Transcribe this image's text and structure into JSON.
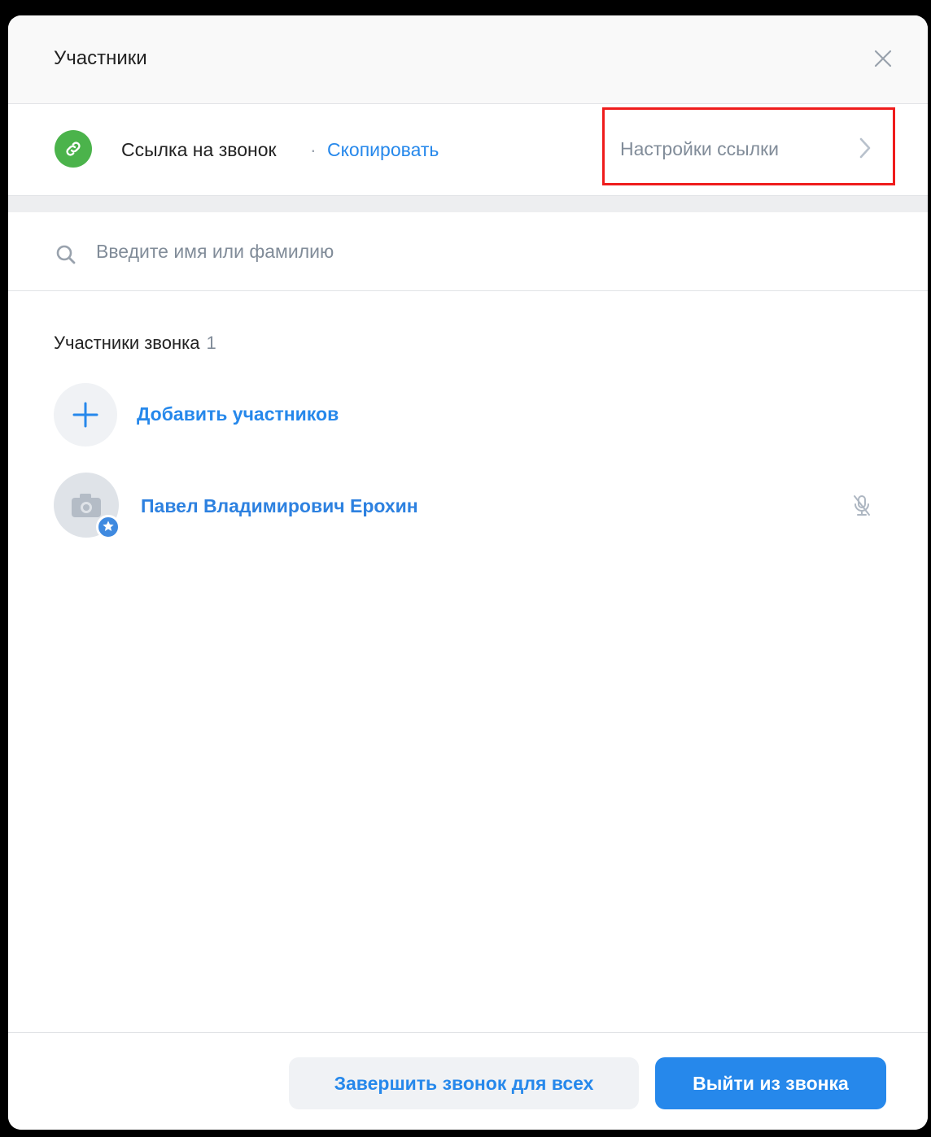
{
  "header": {
    "title": "Участники",
    "close_icon": "close-icon"
  },
  "call_link": {
    "icon": "link-icon",
    "icon_color": "#4bb34b",
    "label": "Ссылка на звонок",
    "separator": "·",
    "copy_label": "Скопировать",
    "settings_label": "Настройки ссылки",
    "settings_icon": "chevron-right-icon",
    "highlight_color": "#ef1c1c"
  },
  "search": {
    "icon": "search-icon",
    "placeholder": "Введите имя или фамилию",
    "value": ""
  },
  "participants": {
    "title": "Участники звонка",
    "count": "1",
    "add_label": "Добавить участников",
    "add_icon": "plus-icon",
    "items": [
      {
        "name": "Павел Владимирович Ерохин",
        "avatar_icon": "camera-icon",
        "badge_icon": "star-icon",
        "mic_icon": "mic-off-icon"
      }
    ]
  },
  "footer": {
    "end_for_all_label": "Завершить звонок для всех",
    "leave_label": "Выйти из звонка",
    "accent_color": "#2688eb"
  }
}
